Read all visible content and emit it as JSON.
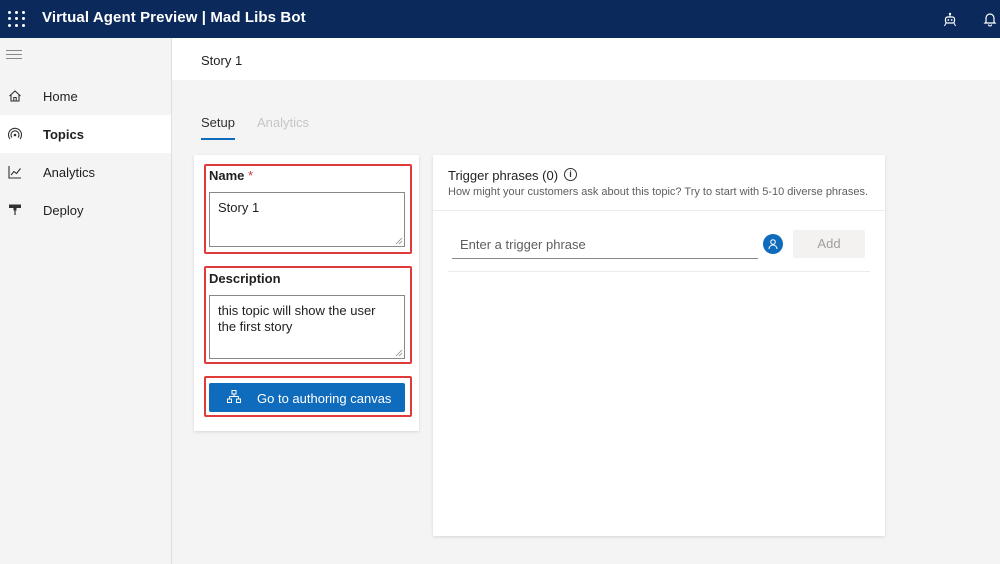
{
  "header": {
    "app_title": "Virtual Agent Preview | Mad Libs Bot",
    "icons": [
      "waffle-icon",
      "bot-icon",
      "notification-icon"
    ]
  },
  "sidebar": {
    "items": [
      {
        "label": "Home",
        "icon": "home-icon",
        "active": false
      },
      {
        "label": "Topics",
        "icon": "topics-icon",
        "active": true
      },
      {
        "label": "Analytics",
        "icon": "analytics-icon",
        "active": false
      },
      {
        "label": "Deploy",
        "icon": "deploy-icon",
        "active": false
      }
    ]
  },
  "breadcrumb": {
    "current": "Story 1"
  },
  "tabs": [
    {
      "label": "Setup",
      "active": true
    },
    {
      "label": "Analytics",
      "active": false
    }
  ],
  "form": {
    "name_label": "Name",
    "name_required_marker": "*",
    "name_value": "Story 1",
    "description_label": "Description",
    "description_value": "this topic will show the user the first story",
    "authoring_button_label": "Go to authoring canvas"
  },
  "triggers": {
    "title": "Trigger phrases (0)",
    "subtitle": "How might your customers ask about this topic? Try to start with 5-10 diverse phrases.",
    "input_placeholder": "Enter a trigger phrase",
    "add_button_label": "Add"
  },
  "colors": {
    "header_bg": "#0b2a5b",
    "accent": "#0f6cbd",
    "highlight_border": "#e03b3b"
  }
}
